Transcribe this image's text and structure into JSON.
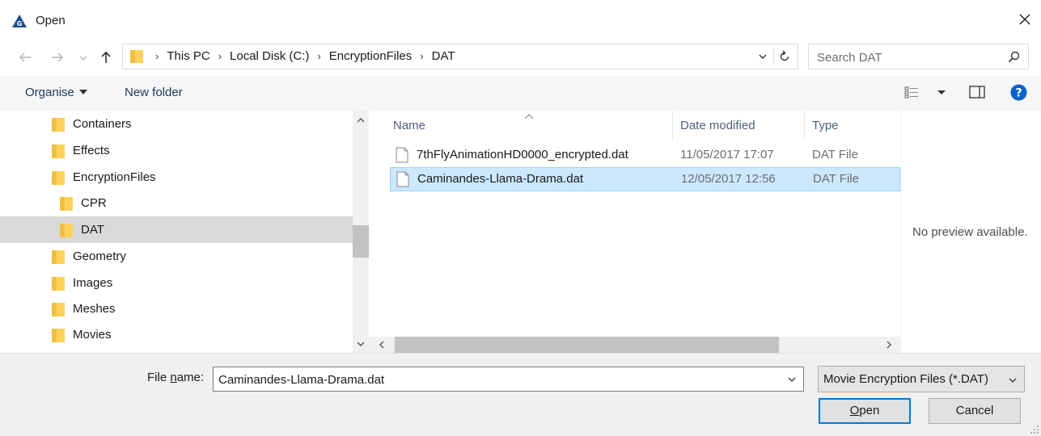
{
  "window": {
    "title": "Open",
    "accent": "#0078d7"
  },
  "nav": {
    "address": {
      "crumbs": [
        "This PC",
        "Local Disk (C:)",
        "EncryptionFiles",
        "DAT"
      ]
    },
    "search": {
      "placeholder": "Search DAT"
    }
  },
  "toolbar": {
    "organise_label": "Organise",
    "new_folder_label": "New folder"
  },
  "tree": {
    "items": [
      {
        "label": "Containers",
        "level": 1,
        "selected": false
      },
      {
        "label": "Effects",
        "level": 1,
        "selected": false
      },
      {
        "label": "EncryptionFiles",
        "level": 1,
        "selected": false
      },
      {
        "label": "CPR",
        "level": 2,
        "selected": false
      },
      {
        "label": "DAT",
        "level": 2,
        "selected": true
      },
      {
        "label": "Geometry",
        "level": 1,
        "selected": false
      },
      {
        "label": "Images",
        "level": 1,
        "selected": false
      },
      {
        "label": "Meshes",
        "level": 1,
        "selected": false
      },
      {
        "label": "Movies",
        "level": 1,
        "selected": false
      }
    ]
  },
  "files": {
    "columns": [
      "Name",
      "Date modified",
      "Type"
    ],
    "rows": [
      {
        "name": "7thFlyAnimationHD0000_encrypted.dat",
        "date": "11/05/2017 17:07",
        "type": "DAT File",
        "selected": false
      },
      {
        "name": "Caminandes-Llama-Drama.dat",
        "date": "12/05/2017 12:56",
        "type": "DAT File",
        "selected": true
      }
    ]
  },
  "preview": {
    "message": "No preview available."
  },
  "footer": {
    "file_name_label_pre": "File ",
    "file_name_label_u": "n",
    "file_name_label_post": "ame:",
    "file_name_value": "Caminandes-Llama-Drama.dat",
    "file_type_value": "Movie Encryption Files (*.DAT)",
    "open_label_u": "O",
    "open_label_rest": "pen",
    "cancel_label": "Cancel"
  }
}
